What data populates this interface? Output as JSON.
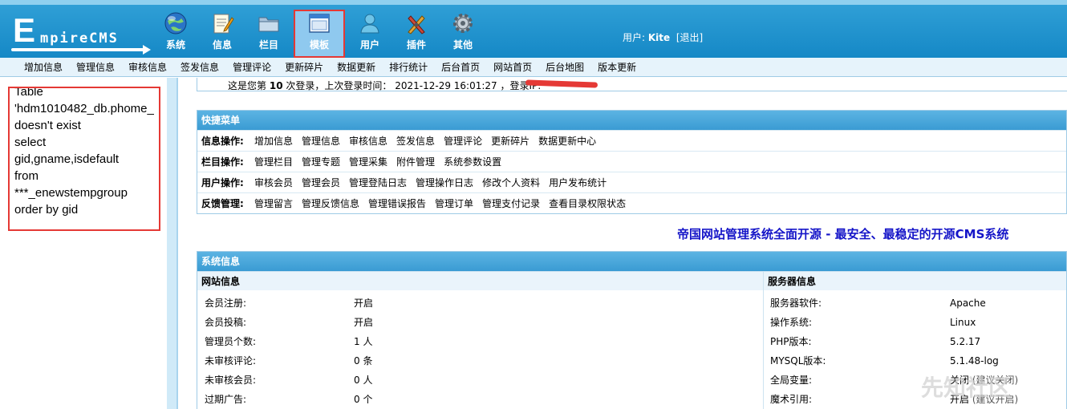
{
  "logo": {
    "e": "E",
    "word": "mpireCMS"
  },
  "topnav": [
    {
      "label": "系统",
      "icon": "globe-icon"
    },
    {
      "label": "信息",
      "icon": "notepad-icon"
    },
    {
      "label": "栏目",
      "icon": "folder-icon"
    },
    {
      "label": "模板",
      "icon": "window-icon",
      "active": true
    },
    {
      "label": "用户",
      "icon": "user-icon"
    },
    {
      "label": "插件",
      "icon": "tools-icon"
    },
    {
      "label": "其他",
      "icon": "gear-icon"
    }
  ],
  "user": {
    "prefix": "用户:",
    "name": "Kite",
    "logout": "[退出]"
  },
  "subnav": [
    "增加信息",
    "管理信息",
    "审核信息",
    "签发信息",
    "管理评论",
    "更新碎片",
    "数据更新",
    "排行统计",
    "后台首页",
    "网站首页",
    "后台地图",
    "版本更新"
  ],
  "error": {
    "text": "Table\n'hdm1010482_db.phome_\ndoesn't exist\nselect\ngid,gname,isdefault\nfrom\n***_enewstempgroup\norder by gid"
  },
  "login": {
    "pre": "这是您第",
    "count": "10",
    "mid": "次登录，上次登录时间：",
    "time": "2021-12-29 16:01:27",
    "ip_label": "，登录IP:"
  },
  "quick": {
    "title": "快捷菜单",
    "rows": [
      {
        "label": "信息操作:",
        "links": [
          "增加信息",
          "管理信息",
          "审核信息",
          "签发信息",
          "管理评论",
          "更新碎片",
          "数据更新中心"
        ]
      },
      {
        "label": "栏目操作:",
        "links": [
          "管理栏目",
          "管理专题",
          "管理采集",
          "附件管理",
          "系统参数设置"
        ]
      },
      {
        "label": "用户操作:",
        "links": [
          "审核会员",
          "管理会员",
          "管理登陆日志",
          "管理操作日志",
          "修改个人资料",
          "用户发布统计"
        ]
      },
      {
        "label": "反馈管理:",
        "links": [
          "管理留言",
          "管理反馈信息",
          "管理错误报告",
          "管理订单",
          "管理支付记录",
          "查看目录权限状态"
        ]
      }
    ]
  },
  "slogan": "帝国网站管理系统全面开源 - 最安全、最稳定的开源CMS系统",
  "sysinfo": {
    "title": "系统信息",
    "site_title": "网站信息",
    "server_title": "服务器信息",
    "site": [
      {
        "k": "会员注册:",
        "v": "开启"
      },
      {
        "k": "会员投稿:",
        "v": "开启"
      },
      {
        "k": "管理员个数:",
        "v": "1 人"
      },
      {
        "k": "未审核评论:",
        "v": "0 条"
      },
      {
        "k": "未审核会员:",
        "v": "0 人"
      },
      {
        "k": "过期广告:",
        "v": "0 个"
      }
    ],
    "server": [
      {
        "k": "服务器软件:",
        "v": "Apache",
        "hint": ""
      },
      {
        "k": "操作系统:",
        "v": "Linux",
        "hint": ""
      },
      {
        "k": "PHP版本:",
        "v": "5.2.17",
        "hint": ""
      },
      {
        "k": "MYSQL版本:",
        "v": "5.1.48-log",
        "hint": ""
      },
      {
        "k": "全局变量:",
        "v": "关闭",
        "hint": "(建议关闭)"
      },
      {
        "k": "魔术引用:",
        "v": "开启",
        "hint": "(建议开启)"
      }
    ]
  },
  "watermark": "先知社区"
}
